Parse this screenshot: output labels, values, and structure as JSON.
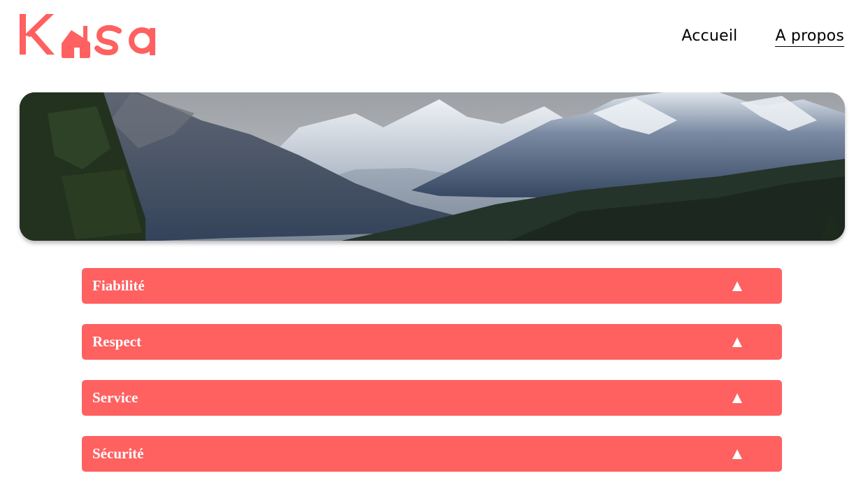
{
  "brand": {
    "logo_text": "Kasa",
    "accent_color": "#ff6060"
  },
  "nav": {
    "home_label": "Accueil",
    "about_label": "A propos",
    "active": "about"
  },
  "banner": {
    "image": "mountain-valley-landscape"
  },
  "collapses": [
    {
      "title": "Fiabilité",
      "icon": "chevron-up-icon"
    },
    {
      "title": "Respect",
      "icon": "chevron-up-icon"
    },
    {
      "title": "Service",
      "icon": "chevron-up-icon"
    },
    {
      "title": "Sécurité",
      "icon": "chevron-up-icon"
    }
  ]
}
